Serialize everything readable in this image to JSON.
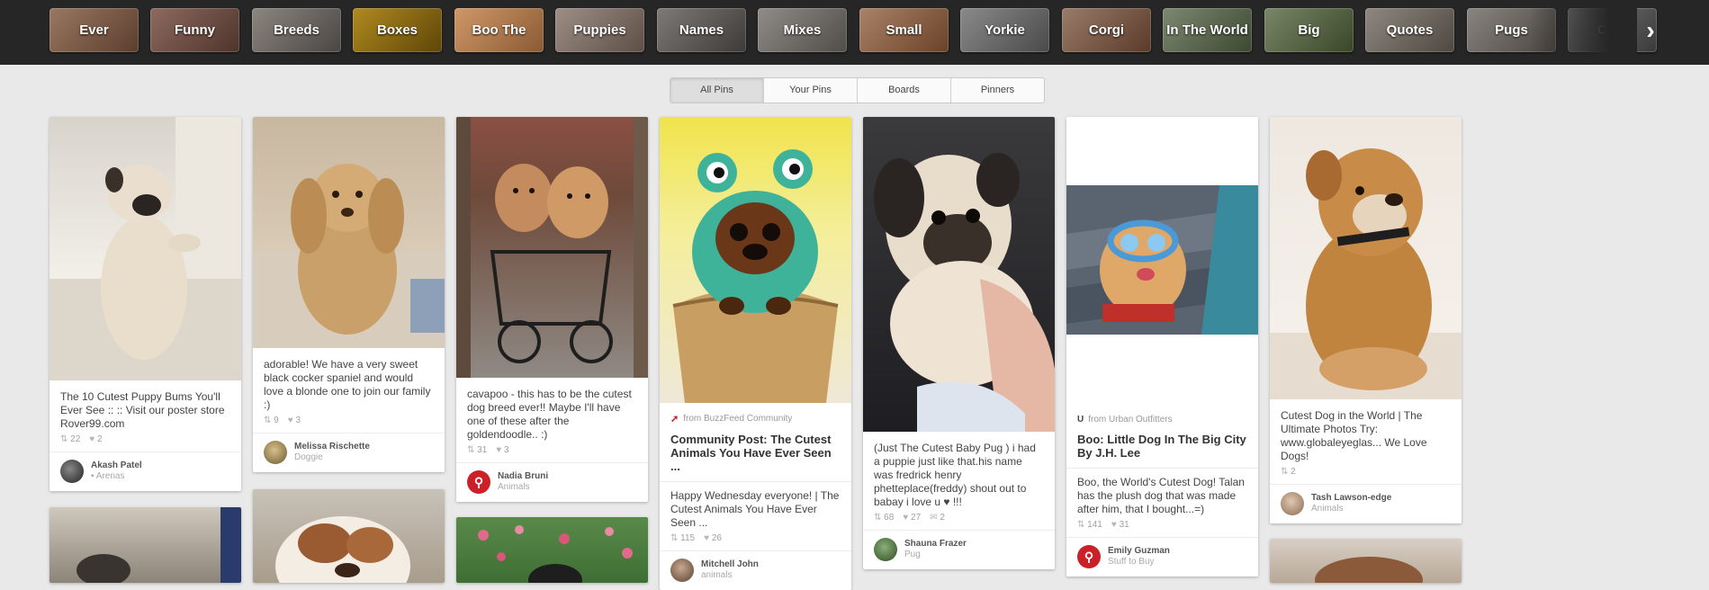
{
  "categories": [
    {
      "label": "Ever",
      "color": "#7a5a45"
    },
    {
      "label": "Funny",
      "color": "#6e5046"
    },
    {
      "label": "Breeds",
      "color": "#6c6660"
    },
    {
      "label": "Boxes",
      "color": "#8a6a14"
    },
    {
      "label": "Boo The",
      "color": "#b07850"
    },
    {
      "label": "Puppies",
      "color": "#7d6e66"
    },
    {
      "label": "Names",
      "color": "#5e5a58"
    },
    {
      "label": "Mixes",
      "color": "#706c68"
    },
    {
      "label": "Small",
      "color": "#8a6248"
    },
    {
      "label": "Yorkie",
      "color": "#6a6a6a"
    },
    {
      "label": "Corgi",
      "color": "#7a5a48"
    },
    {
      "label": "In The World",
      "color": "#5d6850"
    },
    {
      "label": "Big",
      "color": "#5a6648"
    },
    {
      "label": "Quotes",
      "color": "#6e6860"
    },
    {
      "label": "Pugs",
      "color": "#6a6560"
    },
    {
      "label": "Cute",
      "color": "#5a5a5a"
    }
  ],
  "filters": {
    "all_pins": "All Pins",
    "your_pins": "Your Pins",
    "boards": "Boards",
    "pinners": "Pinners"
  },
  "pins": [
    {
      "desc": "The 10 Cutest Puppy Bums You'll Ever See :: :: Visit our poster store Rover99.com",
      "repins": "22",
      "likes": "2",
      "pinner": "Akash Patel",
      "board": "Arenas"
    },
    {
      "desc": "adorable! We have a very sweet black cocker spaniel and would love a blonde one to join our family :)",
      "repins": "9",
      "likes": "3",
      "pinner": "Melissa Rischette",
      "board": "Doggie"
    },
    {
      "desc": "cavapoo - this has to be the cutest dog breed ever!! Maybe I'll have one of these after the goldendoodle.. :)",
      "repins": "31",
      "likes": "3",
      "pinner": "Nadia Bruni",
      "board": "Animals"
    },
    {
      "source": "from BuzzFeed Community",
      "title": "Community Post: The Cutest Animals You Have Ever Seen ...",
      "desc": "Happy Wednesday everyone! | The Cutest Animals You Have Ever Seen ...",
      "repins": "115",
      "likes": "26",
      "pinner": "Mitchell John",
      "board": "animals"
    },
    {
      "desc": "(Just The Cutest Baby Pug ) i had a puppie just like that.his name was fredrick henry phetteplace(freddy) shout out to babay i love u ♥ !!!",
      "repins": "68",
      "likes": "27",
      "comments": "2",
      "pinner": "Shauna Frazer",
      "board": "Pug"
    },
    {
      "source": "from Urban Outfitters",
      "title": "Boo: Little Dog In The Big City By J.H. Lee",
      "desc": "Boo, the World's Cutest Dog! Talan has the plush dog that was made after him, that I bought...=)",
      "repins": "141",
      "likes": "31",
      "pinner": "Emily Guzman",
      "board": "Stuff to Buy"
    },
    {
      "desc": "Cutest Dog in the World | The Ultimate Photos Try: www.globaleyeglas... We Love Dogs!",
      "repins": "2",
      "pinner": "Tash Lawson-edge",
      "board": "Animals"
    }
  ],
  "icons": {
    "repin": "repin-icon",
    "like": "heart-icon",
    "comment": "comment-icon",
    "board": "board-icon",
    "next": "chevron-right-icon"
  }
}
